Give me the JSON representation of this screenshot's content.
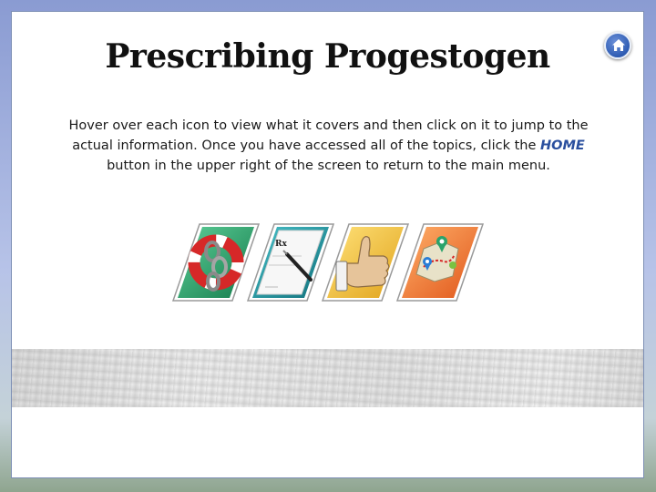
{
  "title": "Prescribing Progestogen",
  "instructions": {
    "before": "Hover over each icon to view what it covers and then click on it to jump to the actual information.  Once you have accessed all of the topics, click the ",
    "home_word": "HOME",
    "after": " button in the upper right of the screen to return to the main menu."
  },
  "icons": [
    {
      "name": "lifebuoy-chain-icon",
      "color": "#2aa36b"
    },
    {
      "name": "prescription-pad-icon",
      "color": "#1f8f9a"
    },
    {
      "name": "thumbs-up-icon",
      "color": "#f2b92a"
    },
    {
      "name": "map-pin-icon",
      "color": "#ef7a2c"
    }
  ],
  "rx_label": "Rx"
}
